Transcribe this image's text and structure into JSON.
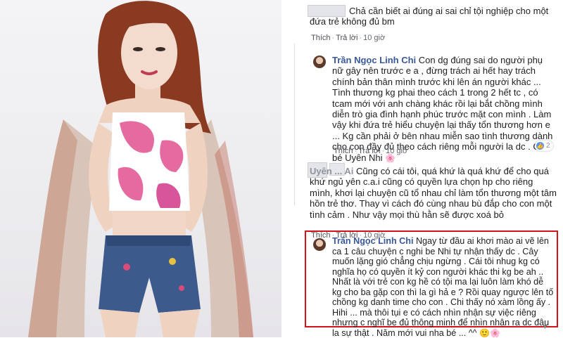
{
  "comments": [
    {
      "author": "",
      "text": "Chả cần biết ai đúng ai sai chỉ tội nghiệp cho một đứa trẻ không đủ bm",
      "like_label": "Thích",
      "reply_label": "Trả lời",
      "time": "10 giờ"
    },
    {
      "author": "Trần Ngọc Linh Chi",
      "text": "Con dg đúng sai do người phụ nữ gây nên trước e a , đừng trách ai hết hay trách chính bản thân mình trước khi lên án người khác ... Tình thương kg phai theo cách 1 trong 2 hết tc , có tcam mới với anh chàng khác rồi lại bắt chồng mình diễn trò gia đình hạnh phúc trước mặt con mình . Làm vậy khi đứa trẻ hiểu chuyện lại thấy tổn thương hơn e ... Kg cần phải ở bên nhau miễn sao tình thương dành cho con đầy đủ theo cách riêng mỗi người la dc . G9 bé Uyên Nhi",
      "like_label": "Thích",
      "reply_label": "Trả lời",
      "time": "10 giờ",
      "reaction_count": "2"
    },
    {
      "author": "Uyên ... Ai",
      "text": "Cũng có cái tôi, quá khứ là quá khứ để cho quá khứ ngủ yên c.a.i cũng có quyền lựa chọn hp cho riêng mình, khơi lại chuyện cũ tổ nhau chỉ làm tổn thương một tâm hồn trẻ thơ. Thay vì cách đó cùng nhau bù đắp cho con một tình cảm . Như vậy mọi thù hằn sẽ được xoá bỏ",
      "like_label": "Thích",
      "reply_label": "Trả lời",
      "time": "10 giờ"
    },
    {
      "author": "Trần Ngọc Linh Chi",
      "text": "Ngay từ đầu ai khơi mào ai vẽ lên ca 1 câu chuyện c nghi be Nhi tự nhận thấy dc . Cây muốn lặng gió chẳng chịu ngừng . Cái tôi nhug kg có nghĩa họ có quyền ít kỷ con người khác thi kg be ah .. Nhất là với trẻ con kg hề có tội ma lại luôn làm khó dễ kg cho ba gặp con thì la gì hả e ? Rồi quay ngược lên tố chồng kg danh time cho con . Chi thấy nó xàm lồng ấy . Hihi ... mà thôi tụi e có cách nhìn nhận sự việc riêng nhưng c nghĩ be đủ thông minh để nhìn nhận ra dc đâu la sự thật . Năm mới vui nha bé ... ^^"
    }
  ],
  "icons": [
    "flower-emoji",
    "like-reaction-icon",
    "scroll-down-arrow-icon"
  ],
  "colors": {
    "author": "#385898",
    "text": "#1c1e21",
    "meta": "#606770",
    "highlight": "#d0141a"
  }
}
